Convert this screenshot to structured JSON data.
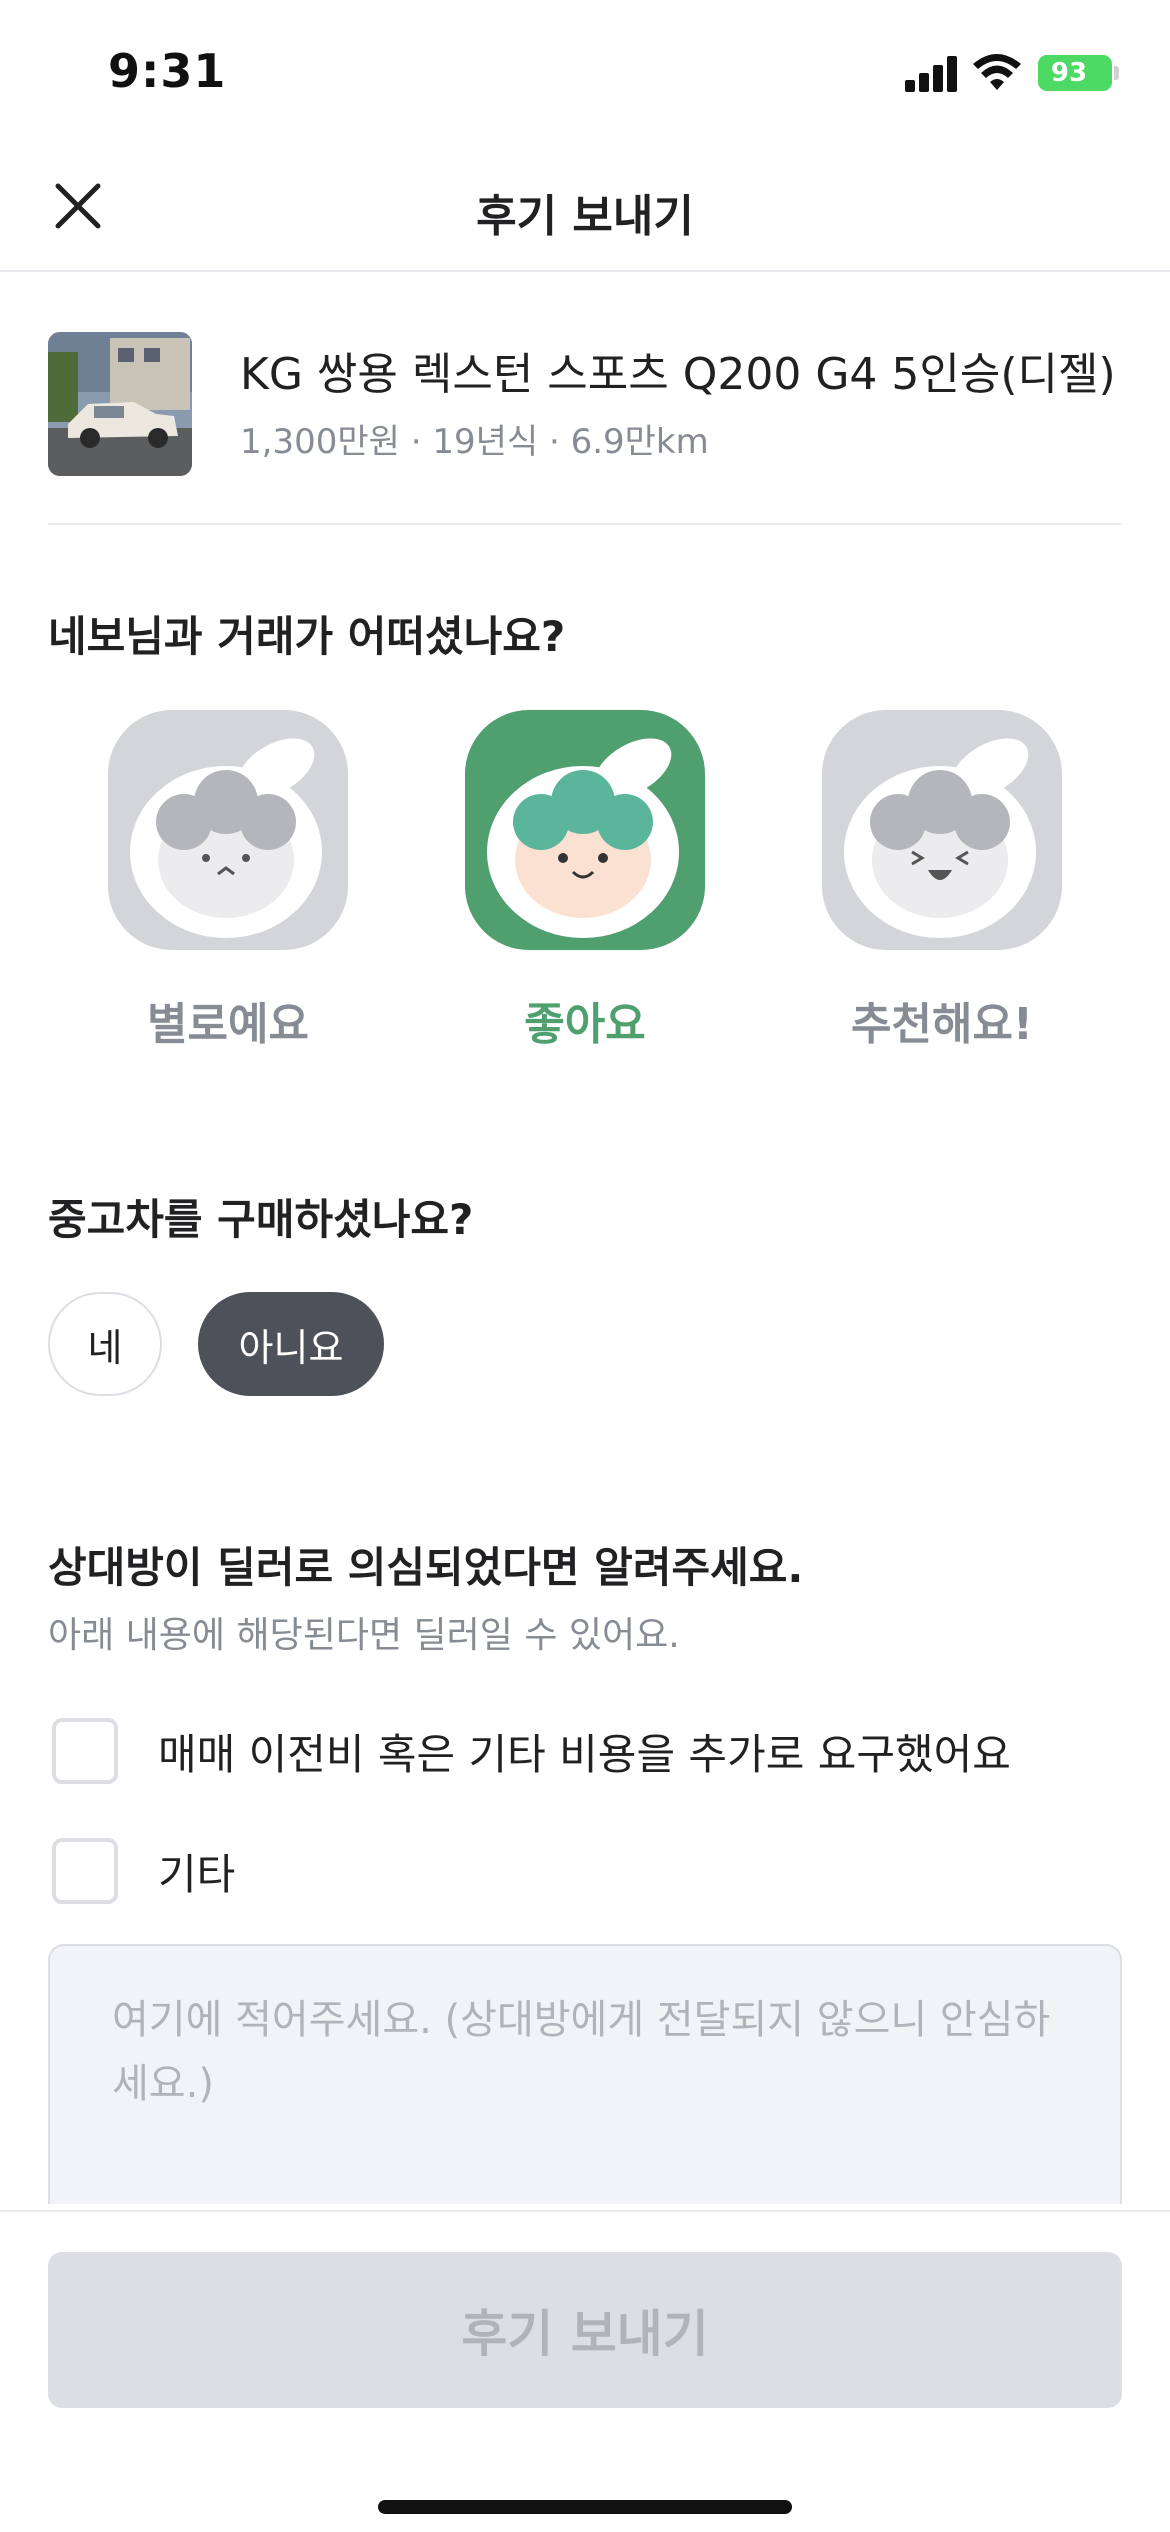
{
  "status_bar": {
    "time": "9:31",
    "battery": "93"
  },
  "header": {
    "title": "후기 보내기"
  },
  "product": {
    "name": "KG 쌍용 렉스턴 스포츠 Q200 G4 5인승(디젤)",
    "meta": "1,300만원 · 19년식 · 6.9만km"
  },
  "rating_section": {
    "question": "네보님과 거래가 어떠셨나요?",
    "options": [
      {
        "label": "별로예요",
        "selected": false
      },
      {
        "label": "좋아요",
        "selected": true
      },
      {
        "label": "추천해요!",
        "selected": false
      }
    ]
  },
  "purchase_section": {
    "question": "중고차를 구매하셨나요?",
    "yes_label": "네",
    "no_label": "아니요",
    "selected": "아니요"
  },
  "dealer_section": {
    "title": "상대방이 딜러로 의심되었다면 알려주세요.",
    "subtitle": "아래 내용에 해당된다면 딜러일 수 있어요.",
    "options": [
      {
        "label": "매매 이전비 혹은 기타 비용을 추가로 요구했어요",
        "checked": false
      },
      {
        "label": "기타",
        "checked": false
      }
    ],
    "memo_placeholder": "여기에 적어주세요. (상대방에게 전달되지 않으니 안심하세요.)"
  },
  "footer": {
    "submit_label": "후기 보내기"
  },
  "colors": {
    "accent_green": "#4f9f6f",
    "selected_chip": "#4d5159",
    "disabled_button": "#dcdee3",
    "battery_green": "#4cd964"
  }
}
